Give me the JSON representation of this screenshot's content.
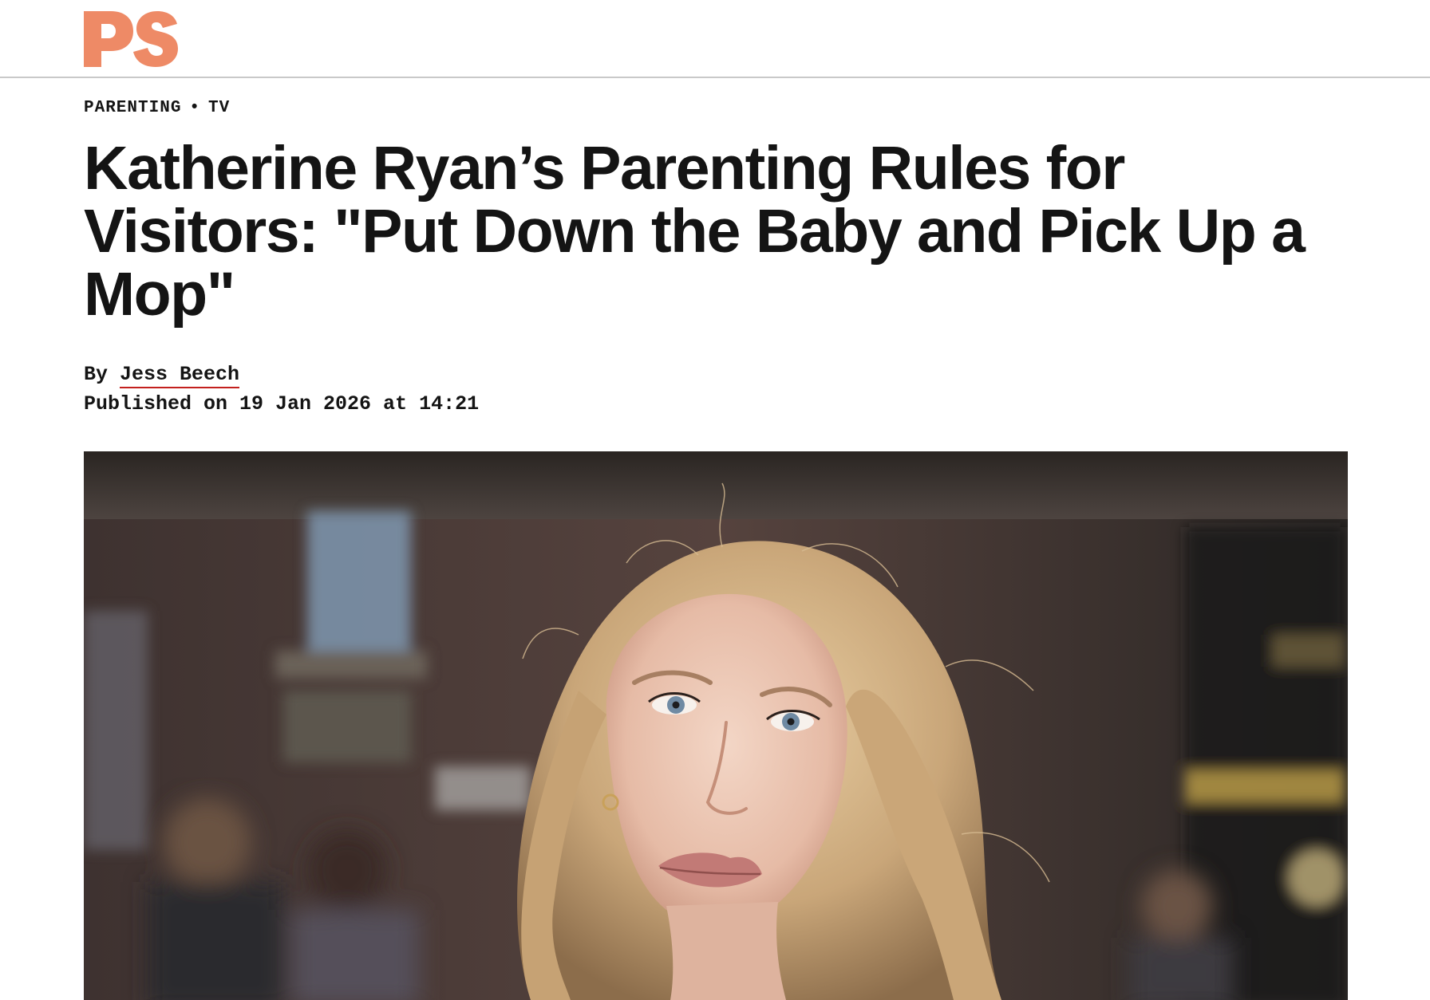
{
  "site": {
    "logo_text": "PS",
    "logo_color": "#ee8a66"
  },
  "article": {
    "categories": [
      "PARENTING",
      "TV"
    ],
    "separator": "•",
    "headline": "Katherine Ryan’s Parenting Rules for Visitors: \"Put Down the Baby and Pick Up a Mop\"",
    "byline_prefix": "By",
    "author": "Jess Beech",
    "published": "Published on 19 Jan 2026 at 14:21",
    "accent_color": "#c3201d"
  },
  "hero_image": {
    "alt": "Portrait of a woman with long wavy blonde hair against a blurred street background"
  }
}
